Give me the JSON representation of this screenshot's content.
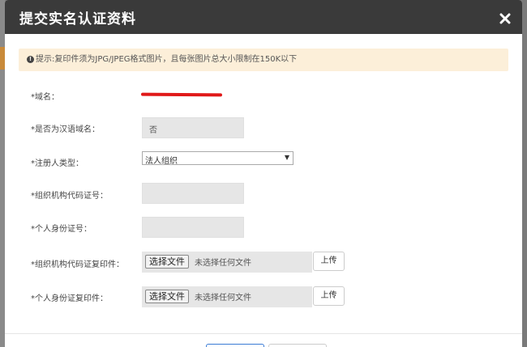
{
  "modal": {
    "title": "提交实名认证资料",
    "close_icon": "close-icon"
  },
  "notice": {
    "text": "提示:复印件须为JPG/JPEG格式图片，且每张图片总大小限制在150K以下"
  },
  "form": {
    "domain": {
      "label": "*域名："
    },
    "is_chinese": {
      "label": "*是否为汉语域名：",
      "value": "否"
    },
    "registrant_type": {
      "label": "*注册人类型：",
      "value": "法人组织"
    },
    "org_code": {
      "label": "*组织机构代码证号：",
      "value": ""
    },
    "id_number": {
      "label": "*个人身份证号：",
      "value": ""
    },
    "org_copy": {
      "label": "*组织机构代码证复印件：",
      "choose": "选择文件",
      "nofile": "未选择任何文件",
      "upload": "上传"
    },
    "id_copy": {
      "label": "*个人身份证复印件：",
      "choose": "选择文件",
      "nofile": "未选择任何文件",
      "upload": "上传"
    }
  },
  "colors": {
    "header_bg": "#3a3a3a",
    "notice_bg": "#fcefd9",
    "redaction": "#e01919"
  }
}
